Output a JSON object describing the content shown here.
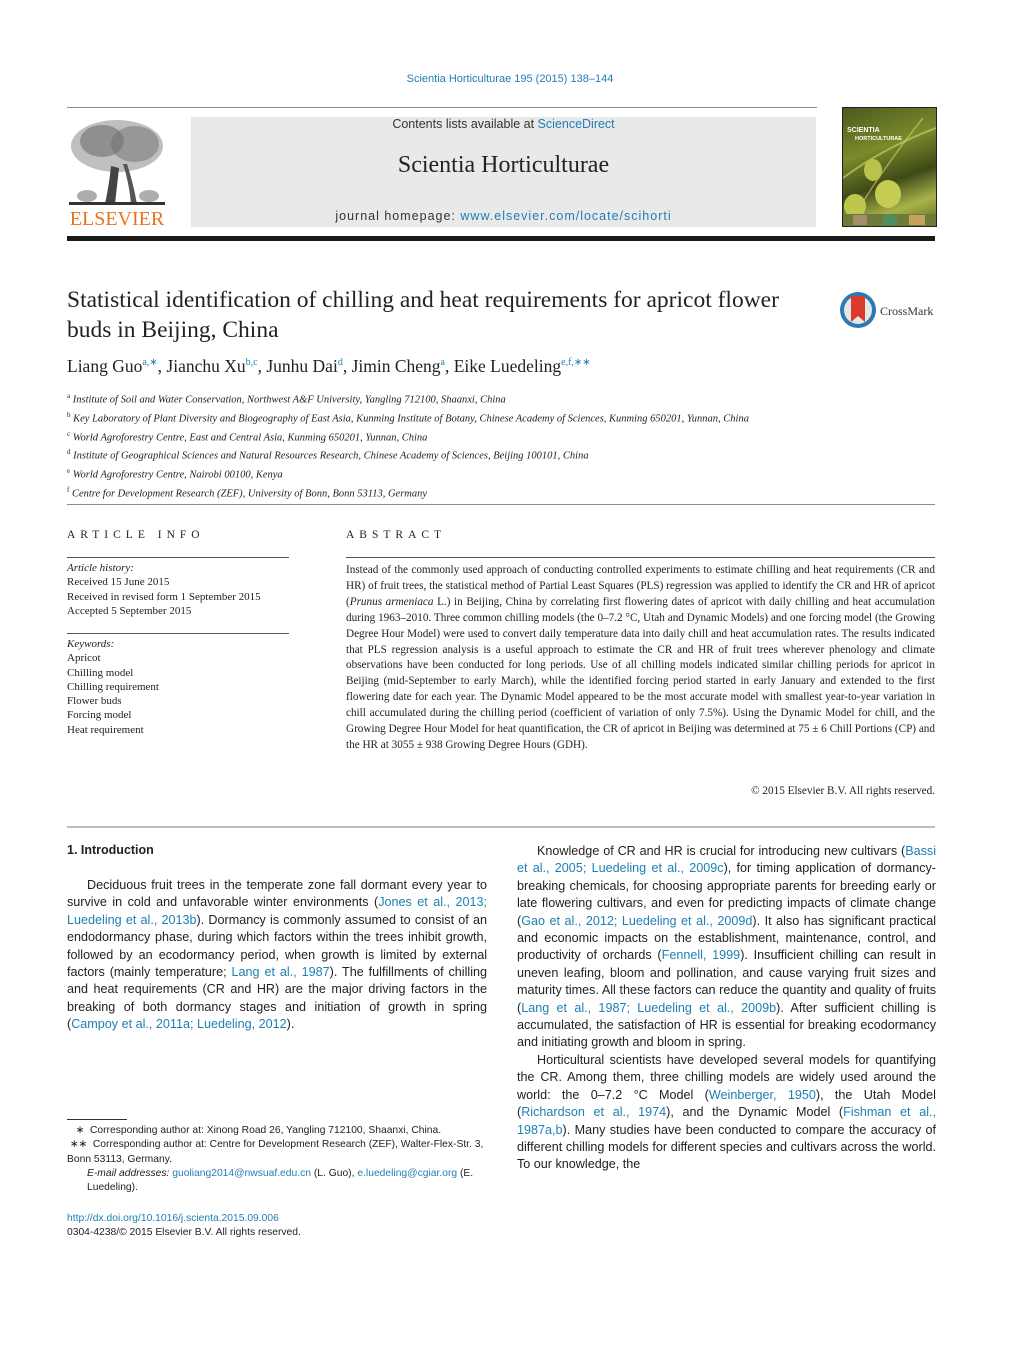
{
  "header": {
    "journal_ref": "Scientia Horticulturae 195 (2015) 138–144",
    "contents_prefix": "Contents lists available at ",
    "contents_link": "ScienceDirect",
    "journal_name": "Scientia Horticulturae",
    "homepage_prefix": "journal homepage: ",
    "homepage_link": "www.elsevier.com/locate/scihorti",
    "publisher_logo_text": "ELSEVIER",
    "cover_text_line1": "SCIENTIA",
    "cover_text_line2": "HORTICULTURAE",
    "crossmark_label": "CrossMark"
  },
  "article": {
    "title": "Statistical identification of chilling and heat requirements for apricot flower buds in Beijing, China",
    "authors": [
      {
        "name": "Liang Guo",
        "sup": "a,∗",
        "sep": ", "
      },
      {
        "name": "Jianchu Xu",
        "sup": "b,c",
        "sep": ", "
      },
      {
        "name": "Junhu Dai",
        "sup": "d",
        "sep": ", "
      },
      {
        "name": "Jimin Cheng",
        "sup": "a",
        "sep": ", "
      },
      {
        "name": "Eike Luedeling",
        "sup": "e,f,∗∗",
        "sep": ""
      }
    ],
    "affiliations": [
      {
        "key": "a",
        "text": "Institute of Soil and Water Conservation, Northwest A&F University, Yangling 712100, Shaanxi, China"
      },
      {
        "key": "b",
        "text": "Key Laboratory of Plant Diversity and Biogeography of East Asia, Kunming Institute of Botany, Chinese Academy of Sciences, Kunming 650201, Yunnan, China"
      },
      {
        "key": "c",
        "text": "World Agroforestry Centre, East and Central Asia, Kunming 650201, Yunnan, China"
      },
      {
        "key": "d",
        "text": "Institute of Geographical Sciences and Natural Resources Research, Chinese Academy of Sciences, Beijing 100101, China"
      },
      {
        "key": "e",
        "text": "World Agroforestry Centre, Nairobi 00100, Kenya"
      },
      {
        "key": "f",
        "text": "Centre for Development Research (ZEF), University of Bonn, Bonn 53113, Germany"
      }
    ]
  },
  "article_info": {
    "heading": "ARTICLE INFO",
    "history_label": "Article history:",
    "history": [
      "Received 15 June 2015",
      "Received in revised form 1 September 2015",
      "Accepted 5 September 2015"
    ],
    "keywords_label": "Keywords:",
    "keywords": [
      "Apricot",
      "Chilling model",
      "Chilling requirement",
      "Flower buds",
      "Forcing model",
      "Heat requirement"
    ]
  },
  "abstract": {
    "heading": "ABSTRACT",
    "text_part1": "Instead of the commonly used approach of conducting controlled experiments to estimate chilling and heat requirements (CR and HR) of fruit trees, the statistical method of Partial Least Squares (PLS) regression was applied to identify the CR and HR of apricot (",
    "species": "Prunus armeniaca",
    "text_part2": " L.) in Beijing, China by correlating first flowering dates of apricot with daily chilling and heat accumulation during 1963–2010. Three common chilling models (the 0–7.2 °C, Utah and Dynamic Models) and one forcing model (the Growing Degree Hour Model) were used to convert daily temperature data into daily chill and heat accumulation rates. The results indicated that PLS regression analysis is a useful approach to estimate the CR and HR of fruit trees wherever phenology and climate observations have been conducted for long periods. Use of all chilling models indicated similar chilling periods for apricot in Beijing (mid-September to early March), while the identified forcing period started in early January and extended to the first flowering date for each year. The Dynamic Model appeared to be the most accurate model with smallest year-to-year variation in chill accumulated during the chilling period (coefficient of variation of only 7.5%). Using the Dynamic Model for chill, and the Growing Degree Hour Model for heat quantification, the CR of apricot in Beijing was determined at 75 ± 6 Chill Portions (CP) and the HR at 3055 ± 938 Growing Degree Hours (GDH).",
    "copyright": "© 2015 Elsevier B.V. All rights reserved."
  },
  "intro": {
    "heading": "1.  Introduction",
    "left_paragraphs": [
      [
        {
          "t": "Deciduous fruit trees in the temperate zone fall dormant every year to survive in cold and unfavorable winter environments ("
        },
        {
          "t": "Jones et al., 2013; Luedeling et al., 2013b",
          "link": true
        },
        {
          "t": "). Dormancy is commonly assumed to consist of an endodormancy phase, during which factors within the trees inhibit growth, followed by an ecodormancy period, when growth is limited by external factors (mainly temperature; "
        },
        {
          "t": "Lang et al., 1987",
          "link": true
        },
        {
          "t": "). The fulfillments of chilling and heat requirements (CR and HR) are the major driving factors in the breaking of both dormancy stages and initiation of growth in spring ("
        },
        {
          "t": "Campoy et al., 2011a; Luedeling, 2012",
          "link": true
        },
        {
          "t": ")."
        }
      ]
    ],
    "right_paragraphs": [
      [
        {
          "t": "Knowledge of CR and HR is crucial for introducing new cultivars ("
        },
        {
          "t": "Bassi et al., 2005; Luedeling et al., 2009c",
          "link": true
        },
        {
          "t": "), for timing application of dormancy-breaking chemicals, for choosing appropriate parents for breeding early or late flowering cultivars, and even for predicting impacts of climate change ("
        },
        {
          "t": "Gao et al., 2012; Luedeling et al., 2009d",
          "link": true
        },
        {
          "t": "). It also has significant practical and economic impacts on the establishment, maintenance, control, and productivity of orchards ("
        },
        {
          "t": "Fennell, 1999",
          "link": true
        },
        {
          "t": "). Insufficient chilling can result in uneven leafing, bloom and pollination, and cause varying fruit sizes and maturity times. All these factors can reduce the quantity and quality of fruits ("
        },
        {
          "t": "Lang et al., 1987; Luedeling et al., 2009b",
          "link": true
        },
        {
          "t": "). After sufficient chilling is accumulated, the satisfaction of HR is essential for breaking ecodormancy and initiating growth and bloom in spring."
        }
      ],
      [
        {
          "t": "Horticultural scientists have developed several models for quantifying the CR. Among them, three chilling models are widely used around the world: the 0–7.2 °C Model ("
        },
        {
          "t": "Weinberger, 1950",
          "link": true
        },
        {
          "t": "), the Utah Model ("
        },
        {
          "t": "Richardson et al., 1974",
          "link": true
        },
        {
          "t": "), and the Dynamic Model ("
        },
        {
          "t": "Fishman et al., 1987a,b",
          "link": true
        },
        {
          "t": "). Many studies have been conducted to compare the accuracy of different chilling models for different species and cultivars across the world. To our knowledge, the"
        }
      ]
    ]
  },
  "footnotes": {
    "fn1_mark": "∗",
    "fn1": "Corresponding author at: Xinong Road 26, Yangling 712100, Shaanxi, China.",
    "fn2_mark": "∗∗",
    "fn2": "Corresponding author at: Centre for Development Research (ZEF), Walter-Flex-Str. 3, Bonn 53113, Germany.",
    "email_label": "E-mail addresses: ",
    "email1": "guoliang2014@nwsuaf.edu.cn",
    "email1_owner": " (L. Guo), ",
    "email2": "e.luedeling@cgiar.org",
    "email2_owner": " (E. Luedeling).",
    "doi": "http://dx.doi.org/10.1016/j.scienta.2015.09.006",
    "issn_line": "0304-4238/© 2015 Elsevier B.V. All rights reserved."
  }
}
